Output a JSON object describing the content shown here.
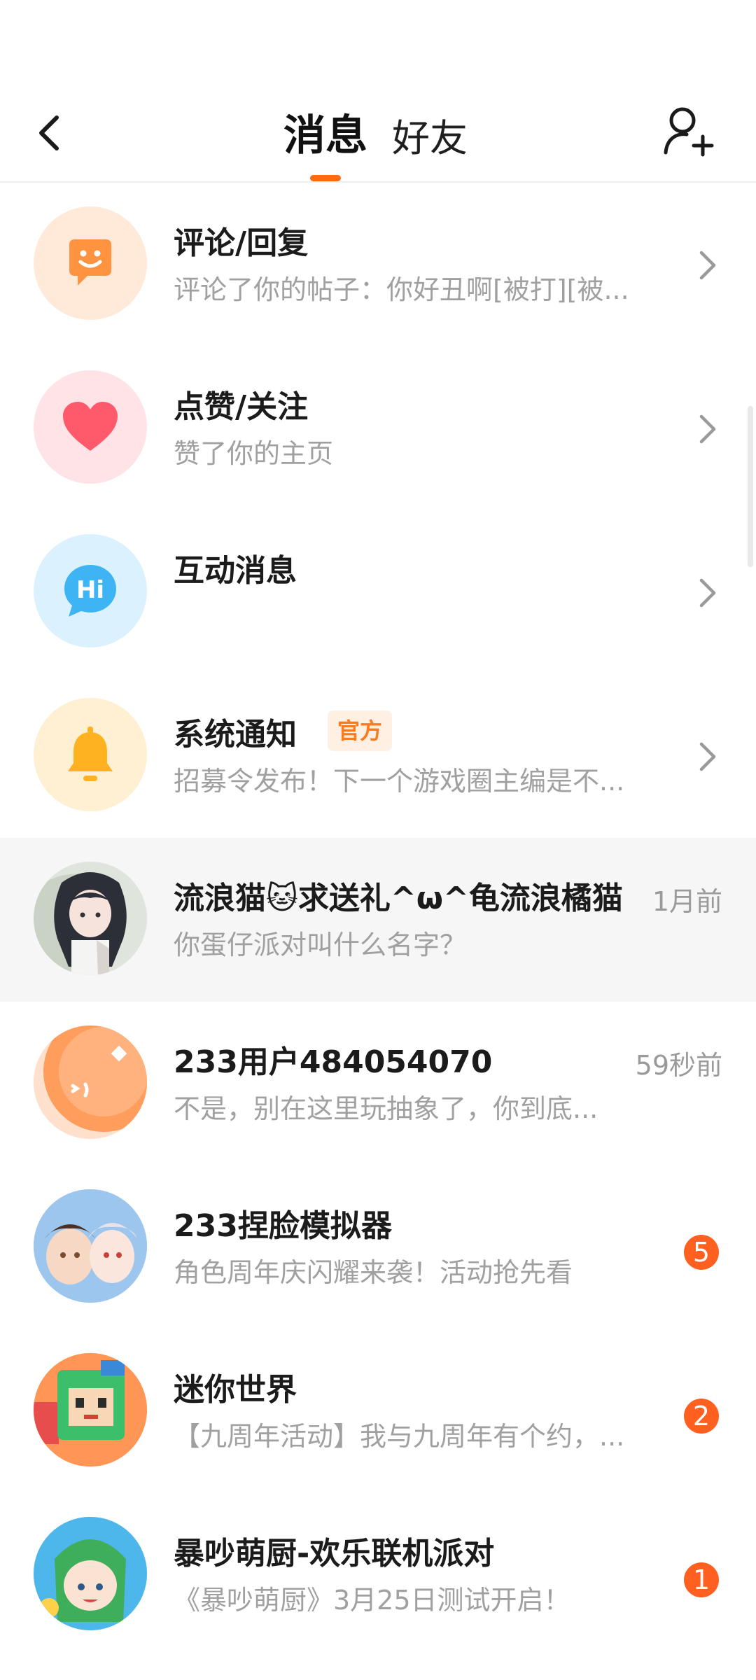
{
  "header": {
    "tab_messages": "消息",
    "tab_friends": "好友",
    "back_icon": "chevron-left-icon",
    "add_friend_icon": "add-user-icon",
    "accent_color": "#ff6a13"
  },
  "system_items": [
    {
      "title": "评论/回复",
      "subtitle": "评论了你的帖子：你好丑啊[被打][被...",
      "icon": "smile-chat-icon",
      "color": "#ff9340"
    },
    {
      "title": "点赞/关注",
      "subtitle": "赞了你的主页",
      "icon": "heart-icon",
      "color": "#ff5a6b"
    },
    {
      "title": "互动消息",
      "subtitle": "",
      "icon": "hi-bubble-icon",
      "color": "#3fb4f5"
    },
    {
      "title": "系统通知",
      "subtitle": "招募令发布！下一个游戏圈主编是不...",
      "icon": "bell-icon",
      "color": "#ffb21f",
      "tag": "官方"
    }
  ],
  "conversations": [
    {
      "name": "流浪猫🐱求送礼^ω^龟流浪橘猫",
      "preview": "你蛋仔派对叫什么名字？",
      "time": "1月前",
      "avatar": "anime-girl-avatar"
    },
    {
      "name": "233用户484054070",
      "preview": "不是，别在这里玩抽象了，你到底...",
      "time": "59秒前",
      "avatar": "default-orange-avatar"
    },
    {
      "name": "233捏脸模拟器",
      "preview": "角色周年庆闪耀来袭！活动抢先看",
      "badge": "5",
      "avatar": "game-face-avatar"
    },
    {
      "name": "迷你世界",
      "preview": "【九周年活动】我与九周年有个约，...",
      "badge": "2",
      "avatar": "mini-world-avatar"
    },
    {
      "name": "暴吵萌厨-欢乐联机派对",
      "preview": "《暴吵萌厨》3月25日测试开启！",
      "badge": "1",
      "avatar": "cooking-game-avatar"
    }
  ]
}
